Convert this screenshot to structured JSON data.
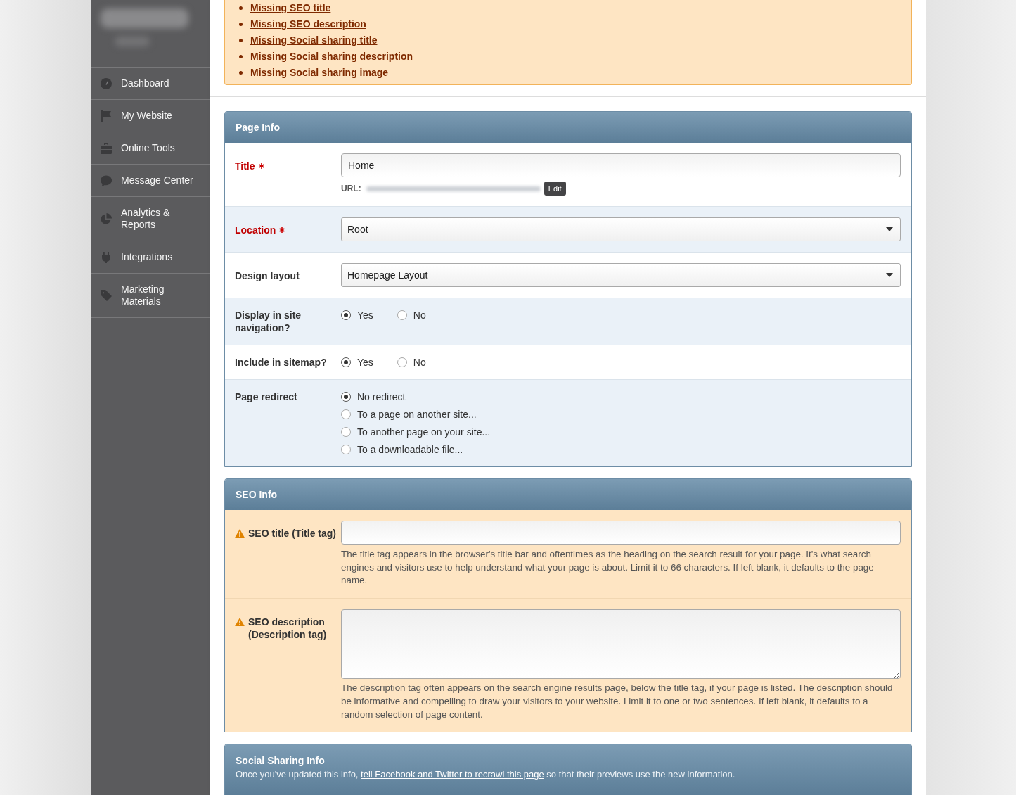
{
  "sidebar": {
    "items": [
      {
        "label": "Dashboard"
      },
      {
        "label": "My Website"
      },
      {
        "label": "Online Tools"
      },
      {
        "label": "Message Center"
      },
      {
        "label": "Analytics & Reports"
      },
      {
        "label": "Integrations"
      },
      {
        "label": "Marketing Materials"
      }
    ]
  },
  "warnings": {
    "items": [
      "Missing SEO title",
      "Missing SEO description",
      "Missing Social sharing title",
      "Missing Social sharing description",
      "Missing Social sharing image"
    ]
  },
  "panels": [
    {
      "title": "Page Info",
      "rows": [
        {
          "kind": "text",
          "label": "Title",
          "required": true,
          "value": "Home",
          "url_label": "URL:",
          "edit_button": "Edit"
        },
        {
          "kind": "select",
          "label": "Location",
          "required": true,
          "value": "Root"
        },
        {
          "kind": "select",
          "label": "Design layout",
          "required": false,
          "value": "Homepage Layout"
        },
        {
          "kind": "radio_inline",
          "label": "Display in site navigation?",
          "required": false,
          "options": [
            {
              "label": "Yes",
              "selected": true
            },
            {
              "label": "No",
              "selected": false
            }
          ]
        },
        {
          "kind": "radio_inline",
          "label": "Include in sitemap?",
          "required": false,
          "options": [
            {
              "label": "Yes",
              "selected": true
            },
            {
              "label": "No",
              "selected": false
            }
          ]
        },
        {
          "kind": "radio_list",
          "label": "Page redirect",
          "required": false,
          "options": [
            {
              "label": "No redirect",
              "selected": true
            },
            {
              "label": "To a page on another site...",
              "selected": false
            },
            {
              "label": "To another page on your site...",
              "selected": false
            },
            {
              "label": "To a downloadable file...",
              "selected": false
            }
          ]
        }
      ]
    },
    {
      "title": "SEO Info",
      "rows": [
        {
          "kind": "text",
          "label": "SEO title (Title tag)",
          "warning": true,
          "help": "The title tag appears in the browser's title bar and oftentimes as the heading on the search result for your page. It's what search engines and visitors use to help understand what your page is about. Limit it to 66 characters. If left blank, it defaults to the page name."
        },
        {
          "kind": "textarea",
          "label": "SEO description (Description tag)",
          "warning": true,
          "help": "The description tag often appears on the search engine results page, below the title tag, if your page is listed. The description should be informative and compelling to draw your visitors to your website. Limit it to one or two sentences. If left blank, it defaults to a random selection of page content."
        }
      ]
    },
    {
      "title": "Social Sharing Info",
      "description": {
        "text_before": "Once you've updated this info, ",
        "link": "tell Facebook and Twitter to recrawl this page",
        "text_after": " so that their previews use the new information."
      }
    }
  ]
}
